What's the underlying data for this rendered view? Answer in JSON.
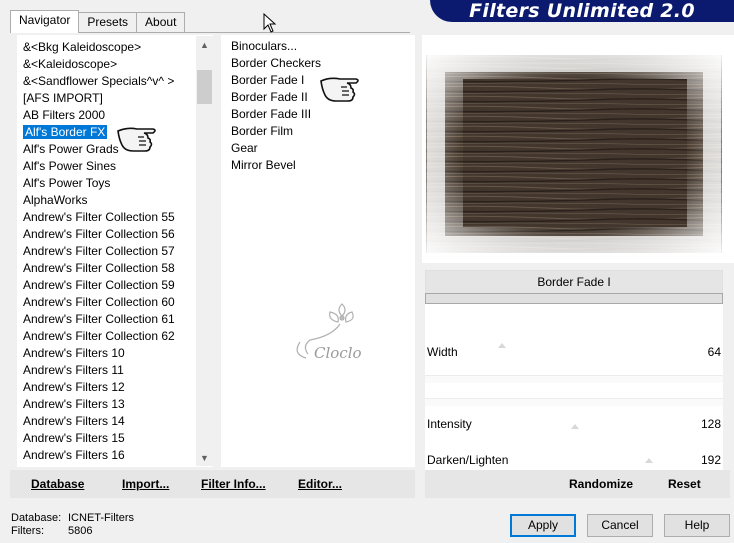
{
  "tabs": [
    {
      "label": "Navigator",
      "active": true
    },
    {
      "label": "Presets",
      "active": false
    },
    {
      "label": "About",
      "active": false
    }
  ],
  "header": {
    "title": "Filters Unlimited 2.0",
    "bg_color": "#0b1a6e"
  },
  "categories": {
    "items": [
      "&<Bkg Kaleidoscope>",
      "&<Kaleidoscope>",
      "&<Sandflower Specials^v^ >",
      "[AFS IMPORT]",
      "AB Filters 2000",
      "Alf's Border FX",
      "Alf's Power Grads",
      "Alf's Power Sines",
      "Alf's Power Toys",
      "AlphaWorks",
      "Andrew's Filter Collection 55",
      "Andrew's Filter Collection 56",
      "Andrew's Filter Collection 57",
      "Andrew's Filter Collection 58",
      "Andrew's Filter Collection 59",
      "Andrew's Filter Collection 60",
      "Andrew's Filter Collection 61",
      "Andrew's Filter Collection 62",
      "Andrew's Filters 10",
      "Andrew's Filters 11",
      "Andrew's Filters 12",
      "Andrew's Filters 13",
      "Andrew's Filters 14",
      "Andrew's Filters 15",
      "Andrew's Filters 16"
    ],
    "selected": "Alf's Border FX",
    "selected_color": "#0078d7"
  },
  "filters": {
    "items": [
      "Binoculars...",
      "Border Checkers",
      "Border Fade I",
      "Border Fade II",
      "Border Fade III",
      "Border Film",
      "Gear",
      "Mirror Bevel"
    ],
    "selected": "Border Fade I"
  },
  "watermark": {
    "text": "Cloclo"
  },
  "preview": {
    "filter_name": "Border Fade I"
  },
  "sliders": [
    {
      "label": "Width",
      "value": "64"
    },
    {
      "label": "Intensity",
      "value": "128"
    },
    {
      "label": "Darken/Lighten",
      "value": "192"
    }
  ],
  "toolbar": {
    "database": "Database",
    "import": "Import...",
    "filter_info": "Filter Info...",
    "editor": "Editor...",
    "randomize": "Randomize",
    "reset": "Reset"
  },
  "status": {
    "database_key": "Database:",
    "database_value": "ICNET-Filters",
    "filters_key": "Filters:",
    "filters_value": "5806"
  },
  "buttons": {
    "apply": "Apply",
    "cancel": "Cancel",
    "help": "Help"
  }
}
